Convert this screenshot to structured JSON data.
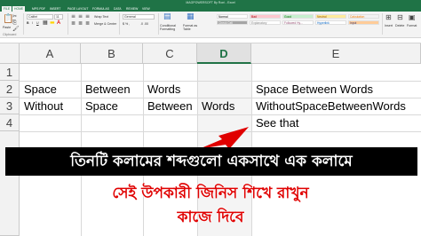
{
  "window": {
    "title": "MAGPOWERSOFT By Roni - Excel"
  },
  "ribbon_tabs": [
    "FILE",
    "HOME",
    "MPS PDF",
    "INSERT",
    "PAGE LAYOUT",
    "FORMULAS",
    "DATA",
    "REVIEW",
    "VIEW"
  ],
  "ribbon": {
    "paste_label": "Paste",
    "clipboard_label": "Clipboard",
    "font_name": "Calibri",
    "font_size": "11",
    "wrap_text_label": "Wrap Text",
    "merge_label": "Merge & Center",
    "number_format": "General",
    "conditional_formatting_label": "Conditional Formatting",
    "format_table_label": "Format as Table",
    "styles": [
      {
        "label": "Normal",
        "bg": "#ffffff",
        "color": "#000000"
      },
      {
        "label": "Bad",
        "bg": "#ffc7ce",
        "color": "#9c0006"
      },
      {
        "label": "Good",
        "bg": "#c6efce",
        "color": "#006100"
      },
      {
        "label": "Neutral",
        "bg": "#ffeb9c",
        "color": "#9c5700"
      },
      {
        "label": "Calculation",
        "bg": "#f2f2f2",
        "color": "#fa7d00"
      },
      {
        "label": "Check Cell",
        "bg": "#a5a5a5",
        "color": "#ffffff"
      },
      {
        "label": "Explanatory",
        "bg": "#ffffff",
        "color": "#7f7f7f"
      },
      {
        "label": "Followed Hy...",
        "bg": "#ffffff",
        "color": "#954f72"
      },
      {
        "label": "Hyperlink",
        "bg": "#ffffff",
        "color": "#0563c1"
      },
      {
        "label": "Input",
        "bg": "#ffcc99",
        "color": "#3f3f76"
      }
    ],
    "insert_label": "Insert",
    "delete_label": "Delete",
    "format_label": "Format"
  },
  "grid": {
    "columns": [
      "A",
      "B",
      "C",
      "D",
      "E"
    ],
    "selected_column": "D",
    "rows": [
      "1",
      "2",
      "3",
      "4"
    ],
    "cells": {
      "A2": "Space",
      "B2": "Between",
      "C2": "Words",
      "E2": "Space  Between  Words",
      "A3": "Without",
      "B3": "Space",
      "C3": "Between",
      "D3": "Words",
      "E3": "WithoutSpaceBetweenWords",
      "E4": "See that"
    }
  },
  "overlay": {
    "banner_text": "তিনটি কলামের শব্দগুলো একসাথে এক কলামে",
    "line1": "সেই উপকারী জিনিস শিখে রাখুন",
    "line2": "কাজে দিবে",
    "banner_color": "#000000",
    "accent_color": "#e00000"
  }
}
